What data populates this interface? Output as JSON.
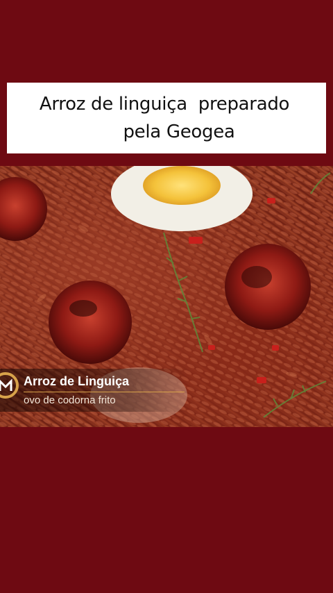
{
  "post": {
    "title_line1": "Arroz de linguiça  preparado",
    "title_line2": "pela Geogea"
  },
  "video": {
    "caption_title": "Arroz de Linguiça",
    "caption_subtitle": "ovo de codorna frito",
    "logo_icon": "masterchef-logo-icon"
  },
  "colors": {
    "background": "#6e0a12",
    "title_box": "#ffffff",
    "caption_rule": "#d8a24a"
  }
}
